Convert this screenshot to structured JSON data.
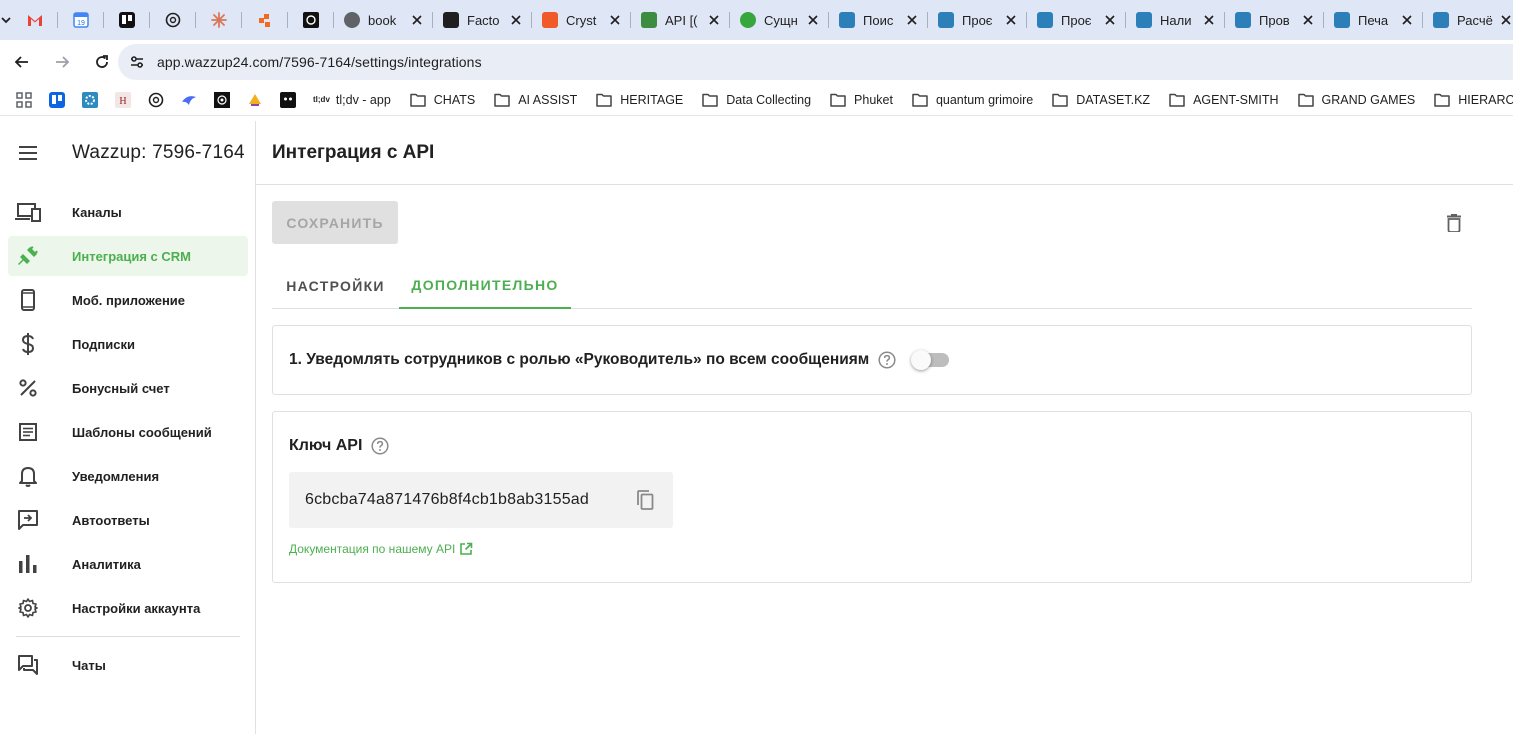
{
  "browser": {
    "pinned_tabs": [
      {
        "name": "gmail",
        "color": "#ea4335"
      },
      {
        "name": "calendar",
        "color": "#4285f4"
      },
      {
        "name": "trello",
        "color": "#111111"
      },
      {
        "name": "chatgpt",
        "color": "#202020"
      },
      {
        "name": "claude",
        "color": "#d97757"
      },
      {
        "name": "make",
        "color": "#f06b1e"
      },
      {
        "name": "app",
        "color": "#111111"
      }
    ],
    "tabs": [
      {
        "title": "book",
        "icon": "globe-icon",
        "color": "#5f6368"
      },
      {
        "title": "Facto",
        "icon": "star-icon",
        "color": "#1f1f1f"
      },
      {
        "title": "Cryst",
        "icon": "crystal-icon",
        "color": "#f05a28"
      },
      {
        "title": "API [(",
        "icon": "api-icon",
        "color": "#3c8d40"
      },
      {
        "title": "Сущн",
        "icon": "wazzup-icon",
        "color": "#37a63c"
      },
      {
        "title": "Поис",
        "icon": "doc-icon",
        "color": "#2c7fb8"
      },
      {
        "title": "Проє",
        "icon": "doc-icon",
        "color": "#2c7fb8"
      },
      {
        "title": "Проє",
        "icon": "doc-icon",
        "color": "#2c7fb8"
      },
      {
        "title": "Нали",
        "icon": "doc-icon",
        "color": "#2c7fb8"
      },
      {
        "title": "Пров",
        "icon": "doc-icon",
        "color": "#2c7fb8"
      },
      {
        "title": "Печа",
        "icon": "doc-icon",
        "color": "#2c7fb8"
      },
      {
        "title": "Расчё",
        "icon": "doc-icon",
        "color": "#2c7fb8"
      }
    ],
    "url": "app.wazzup24.com/7596-7164/settings/integrations",
    "bookmark_icons": [
      {
        "name": "apps",
        "color": "#5f6368"
      },
      {
        "name": "trello",
        "color": "#0c66e4"
      },
      {
        "name": "bookmark-2",
        "color": "#2e8bc0"
      },
      {
        "name": "bookmark-3",
        "color": "#8b1a1a"
      },
      {
        "name": "chatgpt",
        "color": "#202020"
      },
      {
        "name": "bookmark-5",
        "color": "#4a6cf7"
      },
      {
        "name": "bookmark-6",
        "color": "#111111"
      },
      {
        "name": "bookmark-7",
        "color": "#8e44ad"
      },
      {
        "name": "bookmark-8",
        "color": "#111111"
      }
    ],
    "bookmarks": [
      "tl;dv - app",
      "CHATS",
      "AI ASSIST",
      "HERITAGE",
      "Data Collecting",
      "Phuket",
      "quantum grimoire",
      "DATASET.KZ",
      "AGENT-SMITH",
      "GRAND GAMES",
      "HIERARCHY"
    ],
    "tldv_badge": "tl;dv"
  },
  "sidebar": {
    "title": "Wazzup: 7596-7164",
    "items": [
      {
        "label": "Каналы",
        "icon": "devices-icon"
      },
      {
        "label": "Интеграция с CRM",
        "icon": "plug-icon",
        "active": true
      },
      {
        "label": "Моб. приложение",
        "icon": "smartphone-icon"
      },
      {
        "label": "Подписки",
        "icon": "dollar-icon"
      },
      {
        "label": "Бонусный счет",
        "icon": "percent-icon"
      },
      {
        "label": "Шаблоны сообщений",
        "icon": "article-icon"
      },
      {
        "label": "Уведомления",
        "icon": "bell-icon"
      },
      {
        "label": "Автоответы",
        "icon": "auto-reply-icon"
      },
      {
        "label": "Аналитика",
        "icon": "bar-chart-icon"
      },
      {
        "label": "Настройки аккаунта",
        "icon": "gear-icon"
      }
    ],
    "bottom_item": {
      "label": "Чаты",
      "icon": "chat-icon"
    }
  },
  "main": {
    "title": "Интеграция с API",
    "save_label": "СОХРАНИТЬ",
    "tabs": [
      {
        "label": "НАСТРОЙКИ",
        "active": false
      },
      {
        "label": "ДОПОЛНИТЕЛЬНО",
        "active": true
      }
    ],
    "notify_setting": {
      "label": "1. Уведомлять сотрудников с ролью «Руководитель» по всем сообщениям",
      "enabled": false
    },
    "api_key": {
      "title": "Ключ API",
      "value": "6cbcba74a871476b8f4cb1b8ab3155ad"
    },
    "doc_link": "Документация по нашему API"
  },
  "colors": {
    "accent": "#4caf50",
    "active_bg": "#ecf6ea"
  }
}
